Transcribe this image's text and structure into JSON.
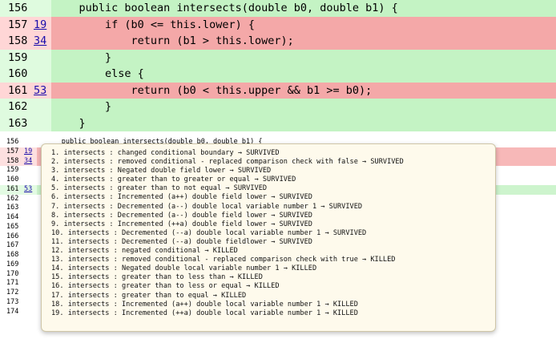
{
  "top_view": {
    "rows": [
      {
        "line": "156",
        "mutation": "",
        "code": "    public boolean intersects(double b0, double b1) {",
        "status": "green"
      },
      {
        "line": "157",
        "mutation": "19",
        "code": "        if (b0 <= this.lower) {",
        "status": "red"
      },
      {
        "line": "158",
        "mutation": "34",
        "code": "            return (b1 > this.lower);",
        "status": "red"
      },
      {
        "line": "159",
        "mutation": "",
        "code": "        }",
        "status": "green"
      },
      {
        "line": "160",
        "mutation": "",
        "code": "        else {",
        "status": "green"
      },
      {
        "line": "161",
        "mutation": "53",
        "code": "            return (b0 < this.upper && b1 >= b0);",
        "status": "red"
      },
      {
        "line": "162",
        "mutation": "",
        "code": "        }",
        "status": "green"
      },
      {
        "line": "163",
        "mutation": "",
        "code": "    }",
        "status": "green"
      }
    ]
  },
  "bottom_view": {
    "rows": [
      {
        "line": "156",
        "mutation": "",
        "code": "      public boolean intersects(double b0, double b1) {",
        "status": "none"
      },
      {
        "line": "157",
        "mutation": "19",
        "code": "",
        "status": "red"
      },
      {
        "line": "158",
        "mutation": "34",
        "code": "",
        "status": "red"
      },
      {
        "line": "159",
        "mutation": "",
        "code": "",
        "status": "none"
      },
      {
        "line": "160",
        "mutation": "",
        "code": "",
        "status": "none"
      },
      {
        "line": "161",
        "mutation": "53",
        "code": "",
        "status": "green"
      },
      {
        "line": "162",
        "mutation": "",
        "code": "",
        "status": "none"
      },
      {
        "line": "163",
        "mutation": "",
        "code": "",
        "status": "none"
      },
      {
        "line": "164",
        "mutation": "",
        "code": "",
        "status": "none"
      },
      {
        "line": "165",
        "mutation": "",
        "code": "",
        "status": "none"
      },
      {
        "line": "166",
        "mutation": "",
        "code": "",
        "status": "none"
      },
      {
        "line": "167",
        "mutation": "",
        "code": "",
        "status": "none"
      },
      {
        "line": "168",
        "mutation": "",
        "code": "",
        "status": "none"
      },
      {
        "line": "169",
        "mutation": "",
        "code": "",
        "status": "none"
      },
      {
        "line": "170",
        "mutation": "",
        "code": "",
        "status": "none"
      },
      {
        "line": "171",
        "mutation": "",
        "code": "",
        "status": "none"
      },
      {
        "line": "172",
        "mutation": "",
        "code": "",
        "status": "none"
      },
      {
        "line": "173",
        "mutation": "",
        "code": "",
        "status": "none"
      },
      {
        "line": "174",
        "mutation": "",
        "code": "       */",
        "status": "none"
      }
    ]
  },
  "popup": {
    "items": [
      "1. intersects : changed conditional boundary → SURVIVED",
      "2. intersects : removed conditional - replaced comparison check with false → SURVIVED",
      "3. intersects : Negated double field lower → SURVIVED",
      "4. intersects : greater than to greater or equal → SURVIVED",
      "5. intersects : greater than to not equal → SURVIVED",
      "6. intersects : Incremented (a++) double field lower → SURVIVED",
      "7. intersects : Decremented (a--) double local variable number 1 → SURVIVED",
      "8. intersects : Decremented (a--) double field lower → SURVIVED",
      "9. intersects : Incremented (++a) double field lower → SURVIVED",
      "10. intersects : Decremented (--a) double local variable number 1 → SURVIVED",
      "11. intersects : Decremented (--a) double fieldlower → SURVIVED",
      "12. intersects : negated conditional → KILLED",
      "13. intersects : removed conditional - replaced comparison check with true → KILLED",
      "14. intersects : Negated double local variable number 1 → KILLED",
      "15. intersects : greater than to less than → KILLED",
      "16. intersects : greater than to less or equal → KILLED",
      "17. intersects : greater than to equal → KILLED",
      "18. intersects : Incremented (a++) double local variable number 1 → KILLED",
      "19. intersects : Incremented (++a) double local variable number 1 → KILLED"
    ]
  },
  "colors": {
    "green_line": "#c4f3c4",
    "red_line": "#f4a8a8",
    "popup_bg": "#fefaec",
    "link": "#1a0dab"
  }
}
